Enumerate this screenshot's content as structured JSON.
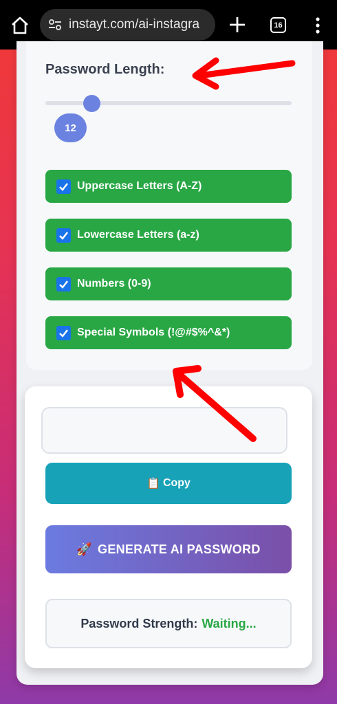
{
  "browser": {
    "url": "instayt.com/ai-instagra",
    "tab_count": "16"
  },
  "settings": {
    "length_label": "Password Length:",
    "length_value": "12",
    "length_slider_fraction": 0.19,
    "options": [
      {
        "label": "Uppercase Letters (A-Z)",
        "checked": true
      },
      {
        "label": "Lowercase Letters (a-z)",
        "checked": true
      },
      {
        "label": "Numbers (0-9)",
        "checked": true
      },
      {
        "label": "Special Symbols (!@#$%^&*)",
        "checked": true
      }
    ]
  },
  "output": {
    "password_value": "",
    "copy_icon": "📋",
    "copy_label": "Copy",
    "generate_icon": "🚀",
    "generate_label": "GENERATE AI PASSWORD",
    "strength_label": "Password Strength:",
    "strength_value": "Waiting..."
  },
  "colors": {
    "option_bg": "#29a745",
    "copy_bg": "#17a2b8",
    "accent": "#6b82e0",
    "annotation_arrow": "#ff0000"
  }
}
